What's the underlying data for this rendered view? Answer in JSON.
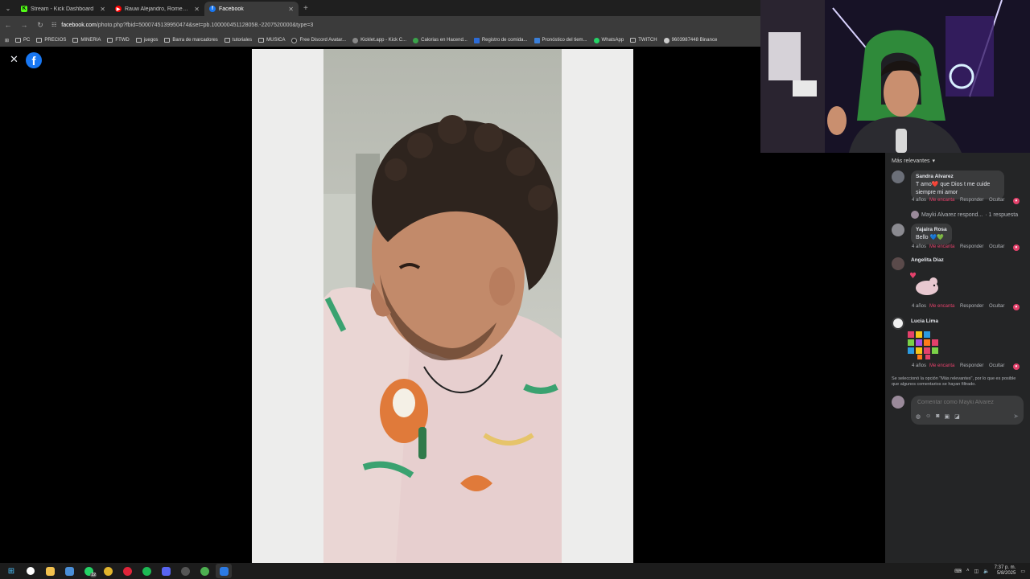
{
  "browser": {
    "tabs": [
      {
        "label": "Stream - Kick Dashboard",
        "fav_color": "#53fc18",
        "fav_letter": "K"
      },
      {
        "label": "Rauw Alejandro, Romeo Santos",
        "fav_color": "#ff0000",
        "fav_letter": "▶"
      },
      {
        "label": "Facebook",
        "fav_color": "#1877f2",
        "fav_letter": "f"
      }
    ],
    "url_domain": "facebook.com",
    "url_path": "/photo.php?fbid=5000745139950474&set=pb.100000451128058.-2207520000&type=3",
    "bookmarks": [
      "PC",
      "PRECIOS",
      "MINERIA",
      "FTWD",
      "juegos",
      "Barra de marcadores",
      "tutoriales",
      "MUSICA",
      "Free Discord Avatar...",
      "Kicklet.app - Kick C...",
      "Calorias en Hacend...",
      "Registro de comida...",
      "Pronóstico del tiem...",
      "WhatsApp",
      "TWITCH",
      "9603987448 Binance"
    ]
  },
  "viewer": {
    "brand": "f",
    "close_icon": "close-icon"
  },
  "comments_panel": {
    "sort_label": "Más relevantes",
    "comments": [
      {
        "name": "Sandra Alvarez",
        "text": "T amo❤️ que Dios t me cuide siempre mi amor",
        "age": "4 años",
        "like_label": "Me encanta",
        "reply_label": "Responder",
        "hide_label": "Ocultar",
        "replies_text": "Mayki Alvarez respond...",
        "replies_count": "· 1 respuesta"
      },
      {
        "name": "Yajaira Rosa",
        "text": "Bello 💙💚",
        "age": "4 años",
        "like_label": "Me encanta",
        "reply_label": "Responder",
        "hide_label": "Ocultar"
      },
      {
        "name": "Angelita Diaz",
        "text": "",
        "age": "4 años",
        "like_label": "Me encanta",
        "reply_label": "Responder",
        "hide_label": "Ocultar"
      },
      {
        "name": "Lucia Lima",
        "text": "",
        "age": "4 años",
        "like_label": "Me encanta",
        "reply_label": "Responder",
        "hide_label": "Ocultar"
      }
    ],
    "notice": "Se seleccionó la opción \"Más relevantes\", por lo que es posible que algunos comentarios se hayan filtrado.",
    "composer_placeholder": "Comentar como Mayki Alvarez"
  },
  "taskbar": {
    "time": "7:37 p. m.",
    "date": "5/8/2025",
    "whatsapp_badge": "22"
  },
  "colors": {
    "accent": "#1877f2",
    "love": "#e4416b",
    "panel": "#242526"
  }
}
